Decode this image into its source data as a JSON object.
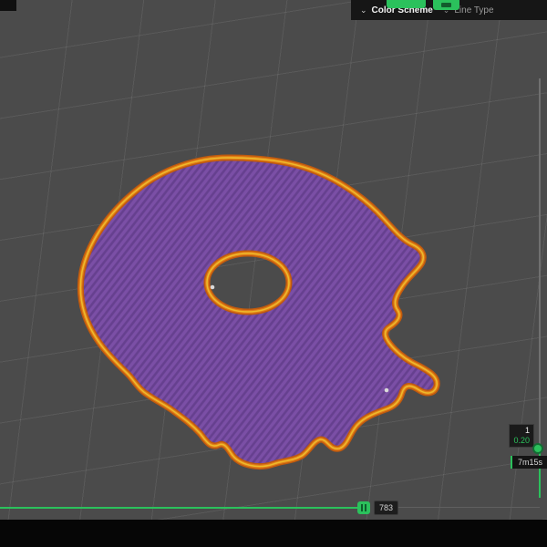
{
  "top_bar": {
    "color_scheme_label": "Color Scheme",
    "line_type_label": "Line Type"
  },
  "icons": {
    "chevron_down": "⌄"
  },
  "right_slider": {
    "layer_number": "1",
    "layer_height": "0.20",
    "time_estimate": "7m15s"
  },
  "bottom_slider": {
    "value": "783"
  },
  "colors": {
    "accent_green": "#2bc15c",
    "perimeter_orange": "#d97a1f",
    "perimeter_yellow": "#e9b82d",
    "infill_purple": "#7b4fa6",
    "viewport_gray": "#4b4b4b",
    "top_bar_black": "#161616"
  }
}
